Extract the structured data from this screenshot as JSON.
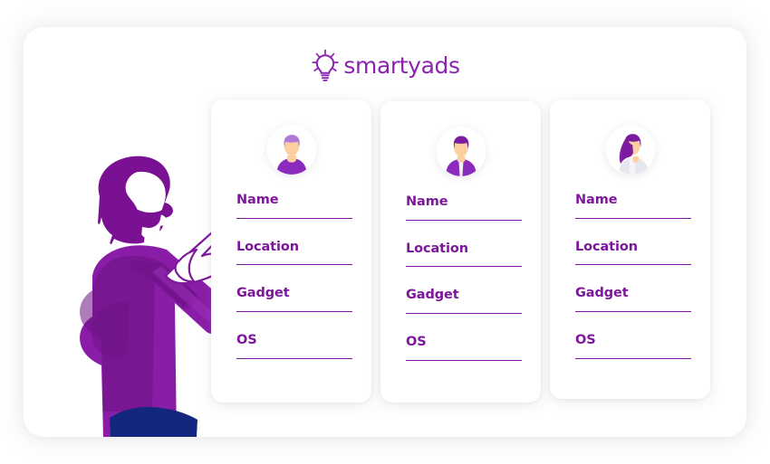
{
  "brand": {
    "name": "smartyads",
    "logo_icon": "lightbulb-icon",
    "logo_color": "#8A24AF"
  },
  "illustration": {
    "name": "man-pointing-illustration",
    "hair_color": "#7A1192",
    "sweater_color": "#8A1DA8",
    "sweater_shadow_color": "#6B1180",
    "pants_color": "#13277F",
    "skin_color": "#FFFFFF",
    "hand_outline_color": "#7D179C"
  },
  "theme": {
    "accent": "#7D179C",
    "panel_background": "#FFFFFF",
    "page_background": "#FFFFFF",
    "card_background": "#FFFFFF"
  },
  "cards": [
    {
      "id": "profile-card-1",
      "avatar": {
        "name": "avatar-person-purple-hair",
        "hair": "#B07BD8",
        "skin": "#FBCFA0",
        "clothing": "#8A2BBE",
        "clothing_alt": "#8A2BBE"
      },
      "fields": [
        {
          "label": "Name",
          "value": ""
        },
        {
          "label": "Location",
          "value": ""
        },
        {
          "label": "Gadget",
          "value": ""
        },
        {
          "label": "OS",
          "value": ""
        }
      ]
    },
    {
      "id": "profile-card-2",
      "avatar": {
        "name": "avatar-person-dark-hair-jacket",
        "hair": "#7B1C9E",
        "skin": "#FBCFA0",
        "clothing": "#8A2BBE",
        "clothing_alt": "#F2F2F6"
      },
      "fields": [
        {
          "label": "Name",
          "value": ""
        },
        {
          "label": "Location",
          "value": ""
        },
        {
          "label": "Gadget",
          "value": ""
        },
        {
          "label": "OS",
          "value": ""
        }
      ]
    },
    {
      "id": "profile-card-3",
      "avatar": {
        "name": "avatar-woman-long-purple-hair",
        "hair": "#7B1C9E",
        "skin": "#FBCFA0",
        "clothing": "#E6E7EE",
        "clothing_alt": "#E6E7EE"
      },
      "fields": [
        {
          "label": "Name",
          "value": ""
        },
        {
          "label": "Location",
          "value": ""
        },
        {
          "label": "Gadget",
          "value": ""
        },
        {
          "label": "OS",
          "value": ""
        }
      ]
    }
  ]
}
